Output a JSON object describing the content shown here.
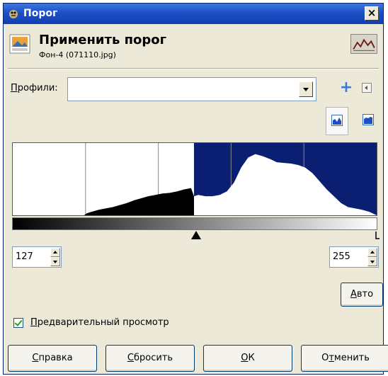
{
  "window": {
    "title": "Порог",
    "close_label": "×"
  },
  "header": {
    "title": "Применить порог",
    "subtitle": "Фон-4 (071110.jpg)"
  },
  "profiles": {
    "label_u": "П",
    "label_rest": "рофили:",
    "value": ""
  },
  "threshold": {
    "low": "127",
    "high": "255"
  },
  "auto_button": {
    "u": "А",
    "rest": "вто"
  },
  "preview": {
    "u": "П",
    "rest": "редварительный просмотр",
    "checked": true
  },
  "buttons": {
    "help": {
      "u": "С",
      "rest": "правка"
    },
    "reset": {
      "u": "С",
      "rest": "бросить"
    },
    "ok": {
      "u": "О",
      "rest": "К"
    },
    "cancel": {
      "pre": "О",
      "u": "т",
      "rest": "менить"
    }
  },
  "colors": {
    "selection": "#0a1f72",
    "histogram": "#000000",
    "titlebar": "#1c4fc4"
  },
  "chart_data": {
    "type": "area",
    "xlim": [
      0,
      255
    ],
    "selection_range": [
      127,
      255
    ],
    "x": [
      0,
      10,
      20,
      30,
      40,
      50,
      52,
      55,
      60,
      65,
      70,
      75,
      80,
      85,
      90,
      95,
      100,
      105,
      110,
      115,
      120,
      125,
      127,
      130,
      135,
      140,
      145,
      150,
      155,
      160,
      165,
      170,
      175,
      180,
      185,
      190,
      195,
      200,
      205,
      210,
      215,
      220,
      225,
      230,
      235,
      240,
      245,
      250,
      255
    ],
    "y": [
      0,
      0,
      0,
      0,
      0,
      0,
      3,
      5,
      8,
      10,
      12,
      15,
      18,
      22,
      25,
      28,
      30,
      32,
      33,
      35,
      38,
      40,
      28,
      30,
      28,
      28,
      30,
      35,
      48,
      70,
      85,
      90,
      87,
      83,
      78,
      77,
      76,
      74,
      70,
      62,
      50,
      38,
      28,
      18,
      12,
      10,
      8,
      5,
      0
    ]
  }
}
